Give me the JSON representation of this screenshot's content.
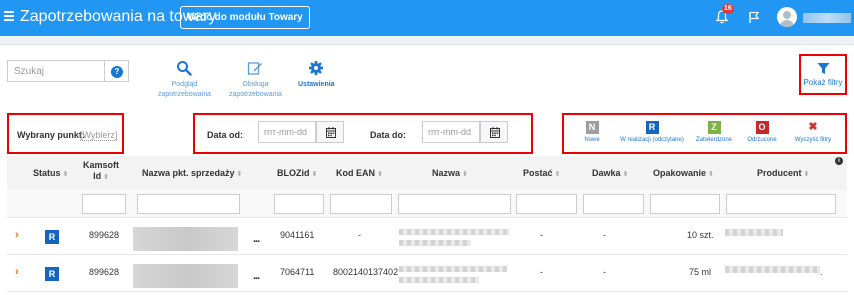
{
  "header": {
    "title": "Zapotrzebowania na towary",
    "back_button": "Wróć do modułu Towary",
    "notification_count": "16",
    "icons": [
      "menu-icon",
      "bell-icon",
      "flag-icon",
      "user-avatar-icon"
    ],
    "accent_color": "#2196f3"
  },
  "toolbar": {
    "search_placeholder": "Szukaj",
    "help_label": "?",
    "tools": [
      {
        "label_line1": "Podgląd",
        "label_line2": "zapotrzebowania",
        "icon": "search-icon"
      },
      {
        "label_line1": "Obsługa",
        "label_line2": "zapotrzebowania",
        "icon": "edit-icon"
      },
      {
        "label_line1": "Ustawienia",
        "label_line2": "",
        "icon": "gear-icon"
      }
    ],
    "filter_button": "Pokaż filtry"
  },
  "filters": {
    "point_label": "Wybrany punkt:",
    "point_link": "[Wybierz]",
    "date_from_label": "Data od:",
    "date_to_label": "Data do:",
    "date_placeholder": "rrrr-mm-dd",
    "statuses": [
      {
        "code": "N",
        "label": "Nowe",
        "color": "#9e9e9e"
      },
      {
        "code": "R",
        "label": "W realizacji (odczytane)",
        "color": "#1565c0"
      },
      {
        "code": "Z",
        "label": "Zatwierdzone",
        "color": "#7cb342"
      },
      {
        "code": "O",
        "label": "Odrzucone",
        "color": "#c62828"
      },
      {
        "code": "✖",
        "label": "Wyczyść filtry",
        "color": "#ffffff"
      }
    ]
  },
  "table": {
    "columns": [
      "Status",
      "Kamsoft Id",
      "Nazwa pkt. sprzedaży",
      "BLOZid",
      "Kod EAN",
      "Nazwa",
      "Postać",
      "Dawka",
      "Opakowanie",
      "Producent"
    ],
    "info_icon": "i",
    "rows": [
      {
        "status": "R",
        "kamsoft_id": "899628",
        "more": "...",
        "blozid": "9041161",
        "ean": "-",
        "postac": "-",
        "dawka": "-",
        "opakowanie": "10 szt.",
        "producent_suffix": ""
      },
      {
        "status": "R",
        "kamsoft_id": "899628",
        "more": "...",
        "blozid": "7064711",
        "ean": "8002140137402",
        "postac": "-",
        "dawka": "-",
        "opakowanie": "75 ml",
        "producent_suffix": "."
      }
    ]
  }
}
